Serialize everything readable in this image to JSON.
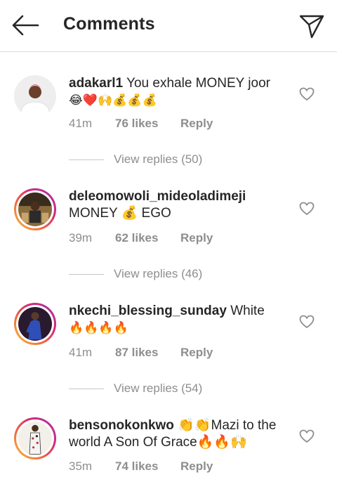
{
  "header": {
    "title": "Comments"
  },
  "comments": [
    {
      "username": "adakarl1",
      "text": "You exhale MONEY joor",
      "emojis": "😂❤️🙌💰💰💰",
      "time": "41m",
      "likes": "76 likes",
      "reply": "Reply",
      "view_replies": "View replies (50)",
      "has_story": false
    },
    {
      "username": "deleomowoli_mideoladimeji",
      "text": "MONEY 💰 EGO",
      "emojis": "",
      "time": "39m",
      "likes": "62 likes",
      "reply": "Reply",
      "view_replies": "View replies (46)",
      "has_story": true
    },
    {
      "username": "nkechi_blessing_sunday",
      "text": "White",
      "emojis": "🔥🔥🔥🔥",
      "time": "41m",
      "likes": "87 likes",
      "reply": "Reply",
      "view_replies": "View replies (54)",
      "has_story": true
    },
    {
      "username": "bensonokonkwo",
      "text": "👏👏Mazi to the world A Son Of Grace🔥🔥🙌",
      "emojis": "",
      "time": "35m",
      "likes": "74 likes",
      "reply": "Reply",
      "view_replies": "",
      "has_story": true
    }
  ],
  "colors": {
    "text": "#262626",
    "muted": "#8e8e8e",
    "divider": "#dbdbdb"
  }
}
